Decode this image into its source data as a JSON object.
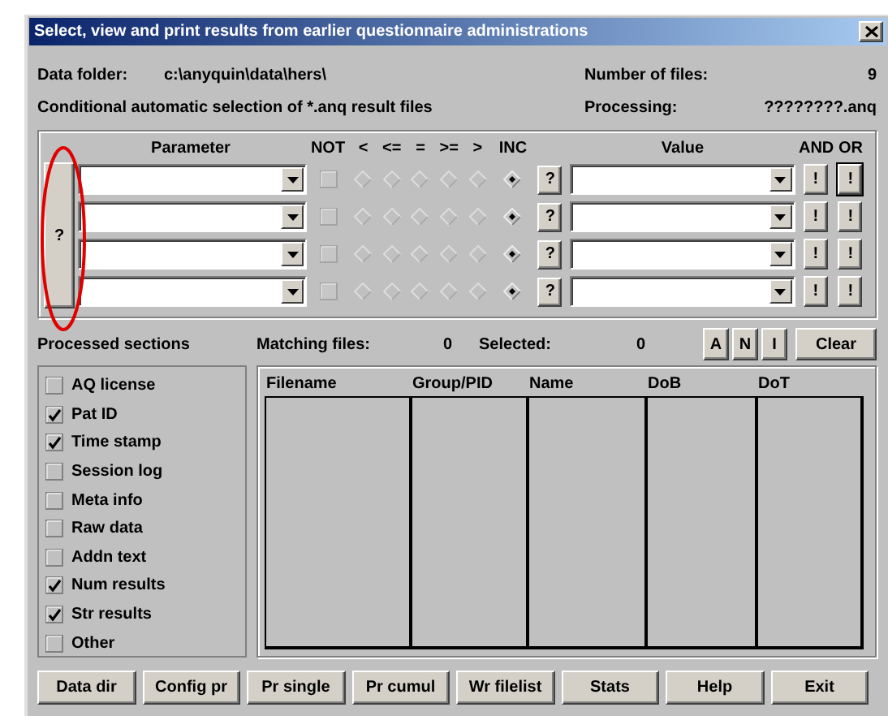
{
  "window": {
    "title": "Select, view and print results from earlier questionnaire administrations"
  },
  "data_folder": {
    "label": "Data folder:",
    "value": "c:\\anyquin\\data\\hers\\"
  },
  "number_of_files": {
    "label": "Number of files:",
    "value": "9"
  },
  "selection_title": "Conditional automatic selection of *.anq result files",
  "processing": {
    "label": "Processing:",
    "value": "????????.anq"
  },
  "criteria": {
    "headers": [
      "Parameter",
      "NOT",
      "<",
      "<=",
      "=",
      ">=",
      ">",
      "INC",
      "Value",
      "AND",
      "OR"
    ],
    "help_button": "?",
    "rows": [
      {
        "not": {
          "checked": false,
          "disabled": true
        },
        "options": [
          {
            "selected": false,
            "disabled": true
          },
          {
            "selected": false,
            "disabled": true
          },
          {
            "selected": false,
            "disabled": true
          },
          {
            "selected": false,
            "disabled": true
          },
          {
            "selected": false,
            "disabled": true
          },
          {
            "selected": true,
            "disabled": false
          }
        ],
        "help_button": "?",
        "and_button": "!",
        "or_button": "!",
        "or_focused": true
      },
      {
        "not": {
          "checked": false,
          "disabled": true
        },
        "options": [
          {
            "selected": false,
            "disabled": true
          },
          {
            "selected": false,
            "disabled": true
          },
          {
            "selected": false,
            "disabled": true
          },
          {
            "selected": false,
            "disabled": true
          },
          {
            "selected": false,
            "disabled": true
          },
          {
            "selected": true,
            "disabled": false
          }
        ],
        "help_button": "?",
        "and_button": "!",
        "or_button": "!",
        "or_focused": false
      },
      {
        "not": {
          "checked": false,
          "disabled": true
        },
        "options": [
          {
            "selected": false,
            "disabled": true
          },
          {
            "selected": false,
            "disabled": true
          },
          {
            "selected": false,
            "disabled": true
          },
          {
            "selected": false,
            "disabled": true
          },
          {
            "selected": false,
            "disabled": true
          },
          {
            "selected": true,
            "disabled": false
          }
        ],
        "help_button": "?",
        "and_button": "!",
        "or_button": "!",
        "or_focused": false
      },
      {
        "not": {
          "checked": false,
          "disabled": true
        },
        "options": [
          {
            "selected": false,
            "disabled": true
          },
          {
            "selected": false,
            "disabled": true
          },
          {
            "selected": false,
            "disabled": true
          },
          {
            "selected": false,
            "disabled": true
          },
          {
            "selected": false,
            "disabled": true
          },
          {
            "selected": true,
            "disabled": false
          }
        ],
        "help_button": "?",
        "and_button": "!",
        "or_button": "!",
        "or_focused": false
      }
    ]
  },
  "sections": {
    "title": "Processed sections",
    "items": [
      {
        "label": "AQ license",
        "checked": false
      },
      {
        "label": "Pat ID",
        "checked": true
      },
      {
        "label": "Time stamp",
        "checked": true
      },
      {
        "label": "Session log",
        "checked": false
      },
      {
        "label": "Meta info",
        "checked": false
      },
      {
        "label": "Raw data",
        "checked": false
      },
      {
        "label": "Addn text",
        "checked": false
      },
      {
        "label": "Num results",
        "checked": true
      },
      {
        "label": "Str results",
        "checked": true
      },
      {
        "label": "Other",
        "checked": false
      }
    ]
  },
  "matching_files": {
    "label": "Matching files:",
    "value": "0"
  },
  "selected_files": {
    "label": "Selected:",
    "value": "0"
  },
  "select_buttons": [
    "A",
    "N",
    "I"
  ],
  "clear_button": "Clear",
  "file_table": {
    "columns": [
      "Filename",
      "Group/PID",
      "Name",
      "DoB",
      "DoT"
    ]
  },
  "buttons": [
    "Data dir",
    "Config pr",
    "Pr single",
    "Pr cumul",
    "Wr filelist",
    "Stats",
    "Help",
    "Exit"
  ]
}
